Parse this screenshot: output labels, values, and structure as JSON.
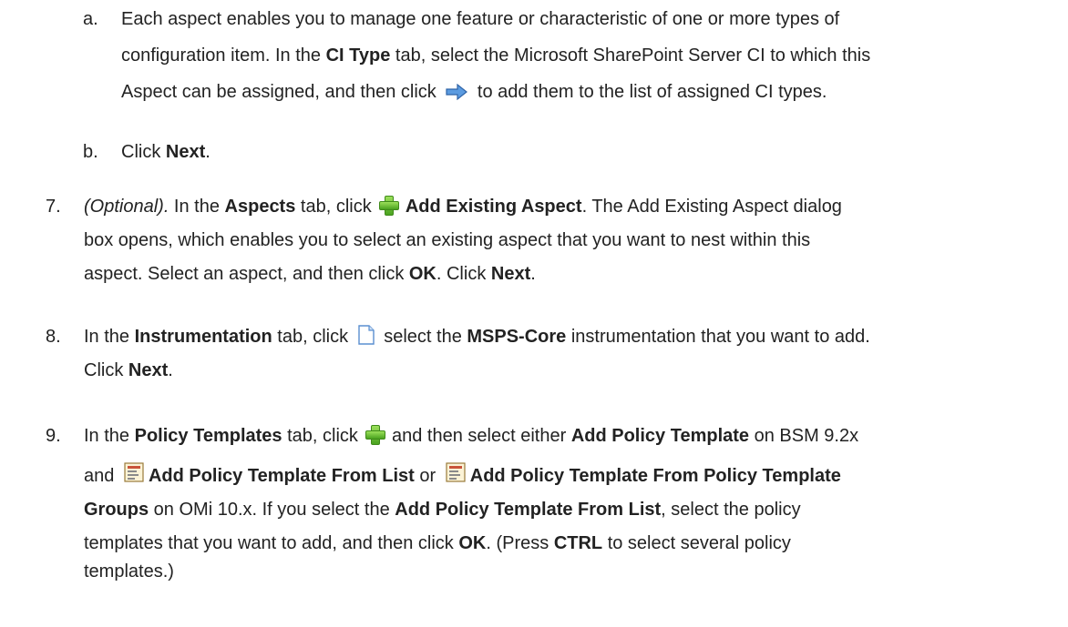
{
  "steps": {
    "a": {
      "marker": "a.",
      "l1": "Each aspect enables you to manage one feature or characteristic of one or more types of",
      "l2_pre": "configuration item. In the ",
      "l2_b1": "CI Type",
      "l2_post": " tab, select the Microsoft SharePoint Server CI to which this",
      "l3_pre": "Aspect can be assigned, and then click ",
      "l3_post": " to add them to the list of assigned CI types."
    },
    "b": {
      "marker": "b.",
      "pre": "Click ",
      "b1": "Next",
      "post": "."
    },
    "s7": {
      "marker": "7.",
      "l1_i": "(Optional).",
      "l1_pre": " In the ",
      "l1_b1": "Aspects",
      "l1_mid": " tab, click ",
      "l1_b2": "Add Existing Aspect",
      "l1_post": ". The Add Existing Aspect dialog",
      "l2": "box opens, which enables you to select an existing aspect that you want to nest within this",
      "l3_pre": "aspect. Select an aspect, and then click ",
      "l3_b1": "OK",
      "l3_mid": ". Click ",
      "l3_b2": "Next",
      "l3_post": "."
    },
    "s8": {
      "marker": "8.",
      "l1_pre": "In the ",
      "l1_b1": "Instrumentation",
      "l1_mid": " tab, click ",
      "l1_mid2": " select the ",
      "l1_b2": "MSPS-Core",
      "l1_post": " instrumentation that you want to add.",
      "l2_pre": "Click ",
      "l2_b1": "Next",
      "l2_post": "."
    },
    "s9": {
      "marker": "9.",
      "l1_pre": "In the ",
      "l1_b1": "Policy Templates",
      "l1_mid": " tab, click ",
      "l1_mid2": " and then select either ",
      "l1_b2": "Add Policy Template",
      "l1_post": "  on BSM 9.2x",
      "l2_pre": "and ",
      "l2_b1": "Add Policy Template From List",
      "l2_mid": " or ",
      "l2_b2": "Add Policy Template From Policy Template",
      "l3_b1": "Groups",
      "l3_mid": " on OMi 10.x. If you select the ",
      "l3_b2": "Add Policy Template From List",
      "l3_post": ", select the policy",
      "l4_pre": "templates that you want to add, and then click ",
      "l4_b1": "OK",
      "l4_mid": ". (Press ",
      "l4_b2": "CTRL",
      "l4_post": " to select several policy",
      "l5": "templates.)"
    }
  },
  "icons": {
    "arrow": "right-arrow-icon",
    "plus": "green-plus-icon",
    "doc": "new-document-icon",
    "template": "policy-template-icon"
  },
  "colors": {
    "text": "#222222",
    "plus": "#4aa21f",
    "arrow": "#3a78c8"
  }
}
